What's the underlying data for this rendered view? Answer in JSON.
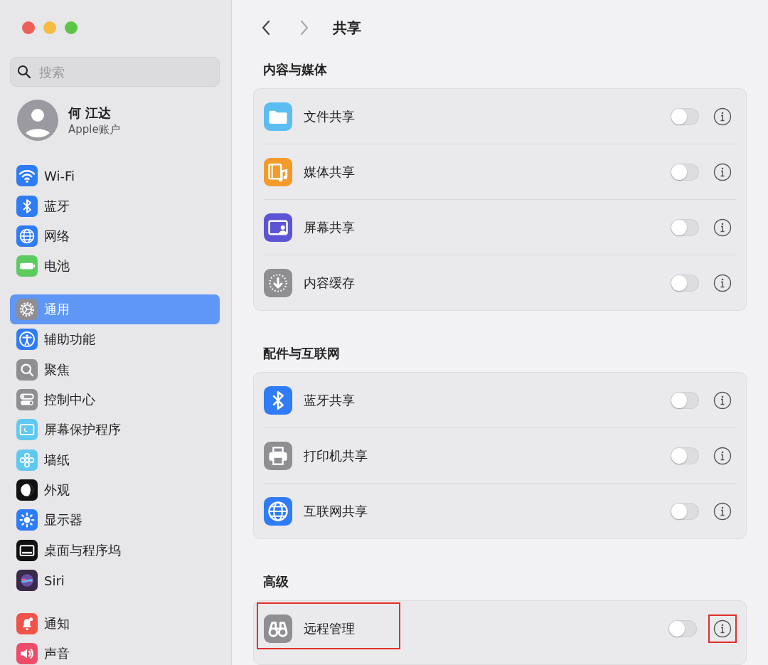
{
  "sidebar": {
    "search": {
      "placeholder": "搜索"
    },
    "account": {
      "name": "何 江达",
      "subtitle": "Apple账户"
    },
    "groups": [
      {
        "items": [
          {
            "kind": "wifi",
            "label": "Wi-Fi",
            "selected": false
          },
          {
            "kind": "bluetooth",
            "label": "蓝牙",
            "selected": false
          },
          {
            "kind": "network",
            "label": "网络",
            "selected": false
          },
          {
            "kind": "battery",
            "label": "电池",
            "selected": false
          }
        ]
      },
      {
        "items": [
          {
            "kind": "general",
            "label": "通用",
            "selected": true
          },
          {
            "kind": "accessibility",
            "label": "辅助功能",
            "selected": false
          },
          {
            "kind": "spotlight",
            "label": "聚焦",
            "selected": false
          },
          {
            "kind": "control",
            "label": "控制中心",
            "selected": false
          },
          {
            "kind": "screensaver",
            "label": "屏幕保护程序",
            "selected": false
          },
          {
            "kind": "wallpaper",
            "label": "墙纸",
            "selected": false
          },
          {
            "kind": "appearance",
            "label": "外观",
            "selected": false
          },
          {
            "kind": "displays",
            "label": "显示器",
            "selected": false
          },
          {
            "kind": "dock",
            "label": "桌面与程序坞",
            "selected": false
          },
          {
            "kind": "siri",
            "label": "Siri",
            "selected": false
          }
        ]
      },
      {
        "items": [
          {
            "kind": "notifications",
            "label": "通知",
            "selected": false
          },
          {
            "kind": "sound",
            "label": "声音",
            "selected": false
          }
        ]
      }
    ]
  },
  "header": {
    "title": "共享"
  },
  "sections": [
    {
      "title": "内容与媒体",
      "rows": [
        {
          "kind": "folder",
          "label": "文件共享",
          "on": false,
          "highlighted": false,
          "info_highlighted": false
        },
        {
          "kind": "media",
          "label": "媒体共享",
          "on": false,
          "highlighted": false,
          "info_highlighted": false
        },
        {
          "kind": "screen",
          "label": "屏幕共享",
          "on": false,
          "highlighted": false,
          "info_highlighted": false
        },
        {
          "kind": "cache",
          "label": "内容缓存",
          "on": false,
          "highlighted": false,
          "info_highlighted": false
        }
      ]
    },
    {
      "title": "配件与互联网",
      "rows": [
        {
          "kind": "bluetooth",
          "label": "蓝牙共享",
          "on": false,
          "highlighted": false,
          "info_highlighted": false
        },
        {
          "kind": "printer",
          "label": "打印机共享",
          "on": false,
          "highlighted": false,
          "info_highlighted": false
        },
        {
          "kind": "network",
          "label": "互联网共享",
          "on": false,
          "highlighted": false,
          "info_highlighted": false
        }
      ]
    },
    {
      "title": "高级",
      "rows": [
        {
          "kind": "binoculars",
          "label": "远程管理",
          "on": false,
          "highlighted": true,
          "info_highlighted": true
        }
      ]
    }
  ]
}
